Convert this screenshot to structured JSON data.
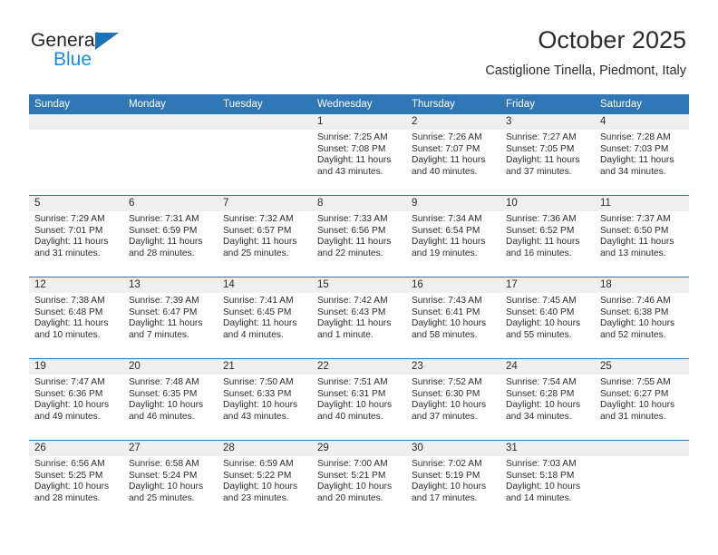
{
  "brand": {
    "name_part1": "General",
    "name_part2": "Blue"
  },
  "header": {
    "title": "October 2025",
    "subtitle": "Castiglione Tinella, Piedmont, Italy"
  },
  "columns": [
    "Sunday",
    "Monday",
    "Tuesday",
    "Wednesday",
    "Thursday",
    "Friday",
    "Saturday"
  ],
  "colors": {
    "header_blue": "#3077b8",
    "brand_blue": "#1b8ce0",
    "daynum_band": "#efefef",
    "text": "#2b2b2b"
  },
  "weeks": [
    [
      {
        "day": "",
        "empty": true
      },
      {
        "day": "",
        "empty": true
      },
      {
        "day": "",
        "empty": true
      },
      {
        "day": "1",
        "sunrise": "Sunrise: 7:25 AM",
        "sunset": "Sunset: 7:08 PM",
        "daylight1": "Daylight: 11 hours",
        "daylight2": "and 43 minutes."
      },
      {
        "day": "2",
        "sunrise": "Sunrise: 7:26 AM",
        "sunset": "Sunset: 7:07 PM",
        "daylight1": "Daylight: 11 hours",
        "daylight2": "and 40 minutes."
      },
      {
        "day": "3",
        "sunrise": "Sunrise: 7:27 AM",
        "sunset": "Sunset: 7:05 PM",
        "daylight1": "Daylight: 11 hours",
        "daylight2": "and 37 minutes."
      },
      {
        "day": "4",
        "sunrise": "Sunrise: 7:28 AM",
        "sunset": "Sunset: 7:03 PM",
        "daylight1": "Daylight: 11 hours",
        "daylight2": "and 34 minutes."
      }
    ],
    [
      {
        "day": "5",
        "sunrise": "Sunrise: 7:29 AM",
        "sunset": "Sunset: 7:01 PM",
        "daylight1": "Daylight: 11 hours",
        "daylight2": "and 31 minutes."
      },
      {
        "day": "6",
        "sunrise": "Sunrise: 7:31 AM",
        "sunset": "Sunset: 6:59 PM",
        "daylight1": "Daylight: 11 hours",
        "daylight2": "and 28 minutes."
      },
      {
        "day": "7",
        "sunrise": "Sunrise: 7:32 AM",
        "sunset": "Sunset: 6:57 PM",
        "daylight1": "Daylight: 11 hours",
        "daylight2": "and 25 minutes."
      },
      {
        "day": "8",
        "sunrise": "Sunrise: 7:33 AM",
        "sunset": "Sunset: 6:56 PM",
        "daylight1": "Daylight: 11 hours",
        "daylight2": "and 22 minutes."
      },
      {
        "day": "9",
        "sunrise": "Sunrise: 7:34 AM",
        "sunset": "Sunset: 6:54 PM",
        "daylight1": "Daylight: 11 hours",
        "daylight2": "and 19 minutes."
      },
      {
        "day": "10",
        "sunrise": "Sunrise: 7:36 AM",
        "sunset": "Sunset: 6:52 PM",
        "daylight1": "Daylight: 11 hours",
        "daylight2": "and 16 minutes."
      },
      {
        "day": "11",
        "sunrise": "Sunrise: 7:37 AM",
        "sunset": "Sunset: 6:50 PM",
        "daylight1": "Daylight: 11 hours",
        "daylight2": "and 13 minutes."
      }
    ],
    [
      {
        "day": "12",
        "sunrise": "Sunrise: 7:38 AM",
        "sunset": "Sunset: 6:48 PM",
        "daylight1": "Daylight: 11 hours",
        "daylight2": "and 10 minutes."
      },
      {
        "day": "13",
        "sunrise": "Sunrise: 7:39 AM",
        "sunset": "Sunset: 6:47 PM",
        "daylight1": "Daylight: 11 hours",
        "daylight2": "and 7 minutes."
      },
      {
        "day": "14",
        "sunrise": "Sunrise: 7:41 AM",
        "sunset": "Sunset: 6:45 PM",
        "daylight1": "Daylight: 11 hours",
        "daylight2": "and 4 minutes."
      },
      {
        "day": "15",
        "sunrise": "Sunrise: 7:42 AM",
        "sunset": "Sunset: 6:43 PM",
        "daylight1": "Daylight: 11 hours",
        "daylight2": "and 1 minute."
      },
      {
        "day": "16",
        "sunrise": "Sunrise: 7:43 AM",
        "sunset": "Sunset: 6:41 PM",
        "daylight1": "Daylight: 10 hours",
        "daylight2": "and 58 minutes."
      },
      {
        "day": "17",
        "sunrise": "Sunrise: 7:45 AM",
        "sunset": "Sunset: 6:40 PM",
        "daylight1": "Daylight: 10 hours",
        "daylight2": "and 55 minutes."
      },
      {
        "day": "18",
        "sunrise": "Sunrise: 7:46 AM",
        "sunset": "Sunset: 6:38 PM",
        "daylight1": "Daylight: 10 hours",
        "daylight2": "and 52 minutes."
      }
    ],
    [
      {
        "day": "19",
        "sunrise": "Sunrise: 7:47 AM",
        "sunset": "Sunset: 6:36 PM",
        "daylight1": "Daylight: 10 hours",
        "daylight2": "and 49 minutes."
      },
      {
        "day": "20",
        "sunrise": "Sunrise: 7:48 AM",
        "sunset": "Sunset: 6:35 PM",
        "daylight1": "Daylight: 10 hours",
        "daylight2": "and 46 minutes."
      },
      {
        "day": "21",
        "sunrise": "Sunrise: 7:50 AM",
        "sunset": "Sunset: 6:33 PM",
        "daylight1": "Daylight: 10 hours",
        "daylight2": "and 43 minutes."
      },
      {
        "day": "22",
        "sunrise": "Sunrise: 7:51 AM",
        "sunset": "Sunset: 6:31 PM",
        "daylight1": "Daylight: 10 hours",
        "daylight2": "and 40 minutes."
      },
      {
        "day": "23",
        "sunrise": "Sunrise: 7:52 AM",
        "sunset": "Sunset: 6:30 PM",
        "daylight1": "Daylight: 10 hours",
        "daylight2": "and 37 minutes."
      },
      {
        "day": "24",
        "sunrise": "Sunrise: 7:54 AM",
        "sunset": "Sunset: 6:28 PM",
        "daylight1": "Daylight: 10 hours",
        "daylight2": "and 34 minutes."
      },
      {
        "day": "25",
        "sunrise": "Sunrise: 7:55 AM",
        "sunset": "Sunset: 6:27 PM",
        "daylight1": "Daylight: 10 hours",
        "daylight2": "and 31 minutes."
      }
    ],
    [
      {
        "day": "26",
        "sunrise": "Sunrise: 6:56 AM",
        "sunset": "Sunset: 5:25 PM",
        "daylight1": "Daylight: 10 hours",
        "daylight2": "and 28 minutes."
      },
      {
        "day": "27",
        "sunrise": "Sunrise: 6:58 AM",
        "sunset": "Sunset: 5:24 PM",
        "daylight1": "Daylight: 10 hours",
        "daylight2": "and 25 minutes."
      },
      {
        "day": "28",
        "sunrise": "Sunrise: 6:59 AM",
        "sunset": "Sunset: 5:22 PM",
        "daylight1": "Daylight: 10 hours",
        "daylight2": "and 23 minutes."
      },
      {
        "day": "29",
        "sunrise": "Sunrise: 7:00 AM",
        "sunset": "Sunset: 5:21 PM",
        "daylight1": "Daylight: 10 hours",
        "daylight2": "and 20 minutes."
      },
      {
        "day": "30",
        "sunrise": "Sunrise: 7:02 AM",
        "sunset": "Sunset: 5:19 PM",
        "daylight1": "Daylight: 10 hours",
        "daylight2": "and 17 minutes."
      },
      {
        "day": "31",
        "sunrise": "Sunrise: 7:03 AM",
        "sunset": "Sunset: 5:18 PM",
        "daylight1": "Daylight: 10 hours",
        "daylight2": "and 14 minutes."
      },
      {
        "day": "",
        "empty": true
      }
    ]
  ]
}
